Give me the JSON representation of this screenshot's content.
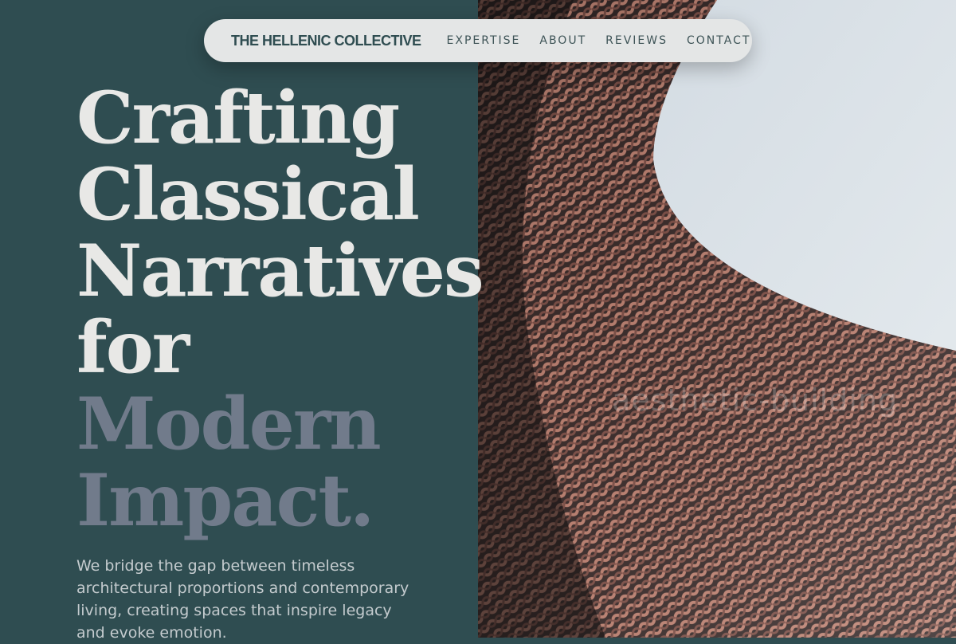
{
  "nav": {
    "brand": "THE HELLENIC COLLECTIVE",
    "links": [
      "EXPERTISE",
      "ABOUT",
      "REVIEWS",
      "CONTACT"
    ]
  },
  "hero": {
    "headline_lines": [
      "Crafting",
      "Classical",
      "Narratives",
      "for"
    ],
    "headline_accent_lines": [
      "Modern",
      "Impact."
    ],
    "subtext": "We bridge the gap between timeless architectural proportions and contemporary living, creating spaces that inspire legacy and evoke emotion."
  },
  "image": {
    "watermark": "aesthetic-building",
    "description_icon": "woven-facade-image"
  },
  "colors": {
    "panel_bg": "#2f4d51",
    "nav_bg": "#e4e6e6",
    "headline_light": "#e8e8e6",
    "headline_accent": "#717b8b",
    "brand_text": "#2f4d51"
  }
}
